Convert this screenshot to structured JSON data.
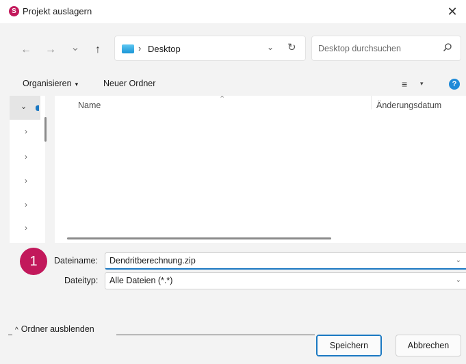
{
  "window": {
    "title": "Projekt auslagern",
    "app_icon_letter": "S",
    "close_glyph": "✕"
  },
  "nav": {
    "back_glyph": "←",
    "forward_glyph": "→",
    "recent_glyph": "⌄",
    "up_glyph": "↑",
    "address": {
      "separator": "›",
      "location": "Desktop",
      "dropdown_glyph": "⌄",
      "refresh_glyph": "↻"
    },
    "search": {
      "placeholder": "Desktop durchsuchen"
    }
  },
  "toolbar": {
    "organize_label": "Organisieren",
    "organize_caret": "▾",
    "new_folder_label": "Neuer Ordner",
    "view_glyph": "≡",
    "view_caret": "▾",
    "help_glyph": "?"
  },
  "nav_pane": {
    "expand_glyph": "⌄",
    "chevron_glyph": "›"
  },
  "file_list": {
    "sort_caret": "⌃",
    "columns": [
      "Name",
      "Änderungsdatum"
    ]
  },
  "annotation": {
    "badge_number": "1"
  },
  "save_form": {
    "filename_label": "Dateiname:",
    "filename_value": "Dendritberechnung.zip",
    "filetype_label": "Dateityp:",
    "filetype_value": "Alle Dateien (*.*)",
    "dropdown_glyph": "⌄"
  },
  "footer": {
    "hide_folders_caret": "^",
    "hide_folders_label": "Ordner ausblenden",
    "save_label": "Speichern",
    "cancel_label": "Abbrechen"
  },
  "colors": {
    "accent": "#1a78c2",
    "badge": "#c2185b",
    "folder": "#1a95d6"
  }
}
